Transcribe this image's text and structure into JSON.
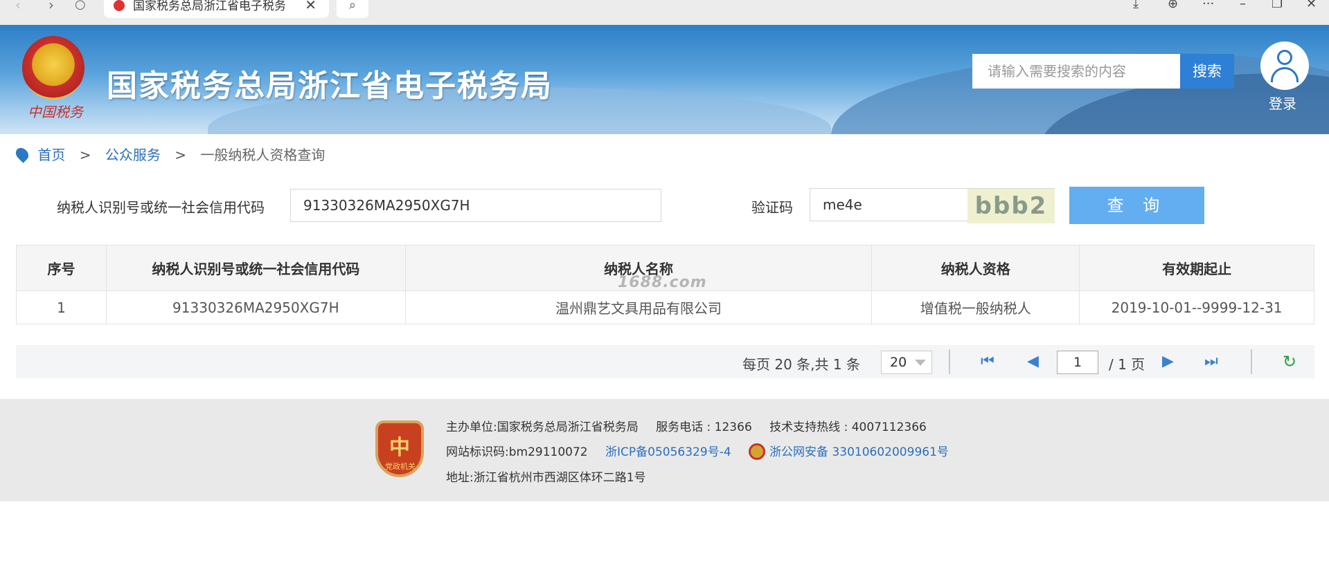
{
  "browser": {
    "tab_title": "国家税务总局浙江省电子税务",
    "close_glyph": "✕"
  },
  "header": {
    "emblem_text": "中国税务",
    "site_title": "国家税务总局浙江省电子税务局",
    "search_placeholder": "请输入需要搜索的内容",
    "search_button": "搜索",
    "login_label": "登录"
  },
  "breadcrumb": {
    "items": [
      "首页",
      "公众服务",
      "一般纳税人资格查询"
    ],
    "separator": ">"
  },
  "query_form": {
    "taxpayer_id_label": "纳税人识别号或统一社会信用代码",
    "taxpayer_id_value": "91330326MA2950XG7H",
    "captcha_label": "验证码",
    "captcha_value": "me4e",
    "captcha_image_text": "bbb2",
    "query_button": "查 询"
  },
  "results_table": {
    "columns": [
      "序号",
      "纳税人识别号或统一社会信用代码",
      "纳税人名称",
      "纳税人资格",
      "有效期起止"
    ],
    "rows": [
      [
        "1",
        "91330326MA2950XG7H",
        "温州鼎艺文具用品有限公司",
        "增值税一般纳税人",
        "2019-10-01--9999-12-31"
      ]
    ],
    "watermark": "1688.com"
  },
  "pager": {
    "summary": "每页 20 条,共 1 条",
    "page_size": "20",
    "current_page": "1",
    "total_pages": "/ 1 页"
  },
  "footer": {
    "badge_text": "党政机关",
    "host_label": "主办单位:",
    "host_value": "国家税务总局浙江省税务局",
    "service_phone": "服务电话 : 12366",
    "support_hotline": "技术支持热线 : 4007112366",
    "site_id_label": "网站标识码:",
    "site_id_value": "bm29110072",
    "icp": "浙ICP备05056329号-4",
    "police_record": "浙公网安备 33010602009961号",
    "address": "地址:浙江省杭州市西湖区体环二路1号"
  }
}
